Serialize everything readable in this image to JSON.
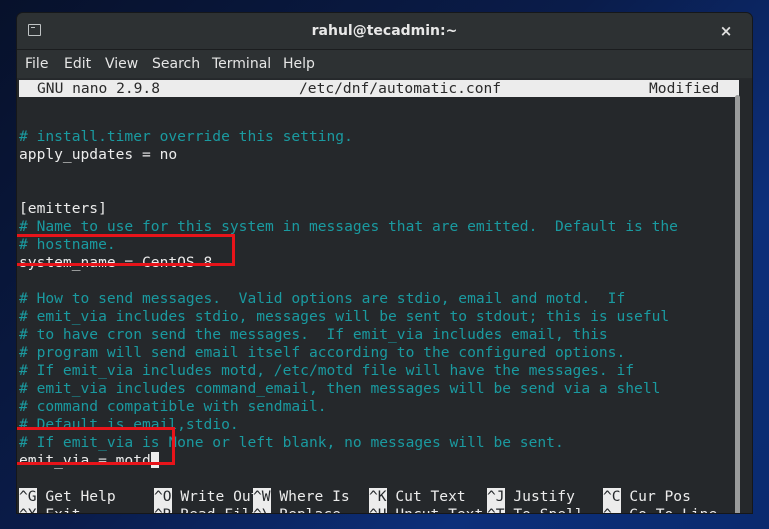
{
  "window": {
    "title": "rahul@tecadmin:~",
    "close_icon": "×"
  },
  "menubar": {
    "items": [
      "File",
      "Edit",
      "View",
      "Search",
      "Terminal",
      "Help"
    ]
  },
  "nano": {
    "version": "GNU nano 2.9.8",
    "filename": "/etc/dnf/automatic.conf",
    "status": "Modified"
  },
  "editor": {
    "lines": [
      {
        "text": "# install.timer override this setting.",
        "type": "comment"
      },
      {
        "text": "apply_updates = no",
        "type": "code"
      },
      {
        "text": "",
        "type": "code"
      },
      {
        "text": "",
        "type": "code"
      },
      {
        "text": "[emitters]",
        "type": "code"
      },
      {
        "text": "# Name to use for this system in messages that are emitted.  Default is the",
        "type": "comment"
      },
      {
        "text": "# hostname.",
        "type": "comment"
      },
      {
        "text": "system_name = CentOS 8",
        "type": "code"
      },
      {
        "text": "",
        "type": "code"
      },
      {
        "text": "# How to send messages.  Valid options are stdio, email and motd.  If",
        "type": "comment"
      },
      {
        "text": "# emit_via includes stdio, messages will be sent to stdout; this is useful",
        "type": "comment"
      },
      {
        "text": "# to have cron send the messages.  If emit_via includes email, this",
        "type": "comment"
      },
      {
        "text": "# program will send email itself according to the configured options.",
        "type": "comment"
      },
      {
        "text": "# If emit_via includes motd, /etc/motd file will have the messages. if",
        "type": "comment"
      },
      {
        "text": "# emit_via includes command_email, then messages will be send via a shell",
        "type": "comment"
      },
      {
        "text": "# command compatible with sendmail.",
        "type": "comment"
      },
      {
        "text": "# Default is email,stdio.",
        "type": "comment"
      },
      {
        "text": "# If emit_via is None or left blank, no messages will be sent.",
        "type": "comment"
      },
      {
        "text": "emit_via = motd",
        "type": "code"
      }
    ],
    "highlight_color": "#e8141a",
    "comment_color": "#1a9aa0"
  },
  "shortcuts": [
    {
      "key": "^G",
      "label": "Get Help"
    },
    {
      "key": "^O",
      "label": "Write Out"
    },
    {
      "key": "^W",
      "label": "Where Is"
    },
    {
      "key": "^K",
      "label": "Cut Text"
    },
    {
      "key": "^J",
      "label": "Justify"
    },
    {
      "key": "^C",
      "label": "Cur Pos"
    },
    {
      "key": "^X",
      "label": "Exit"
    },
    {
      "key": "^R",
      "label": "Read File"
    },
    {
      "key": "^\\",
      "label": "Replace"
    },
    {
      "key": "^U",
      "label": "Uncut Text"
    },
    {
      "key": "^T",
      "label": "To Spell"
    },
    {
      "key": "^_",
      "label": "Go To Line"
    }
  ]
}
